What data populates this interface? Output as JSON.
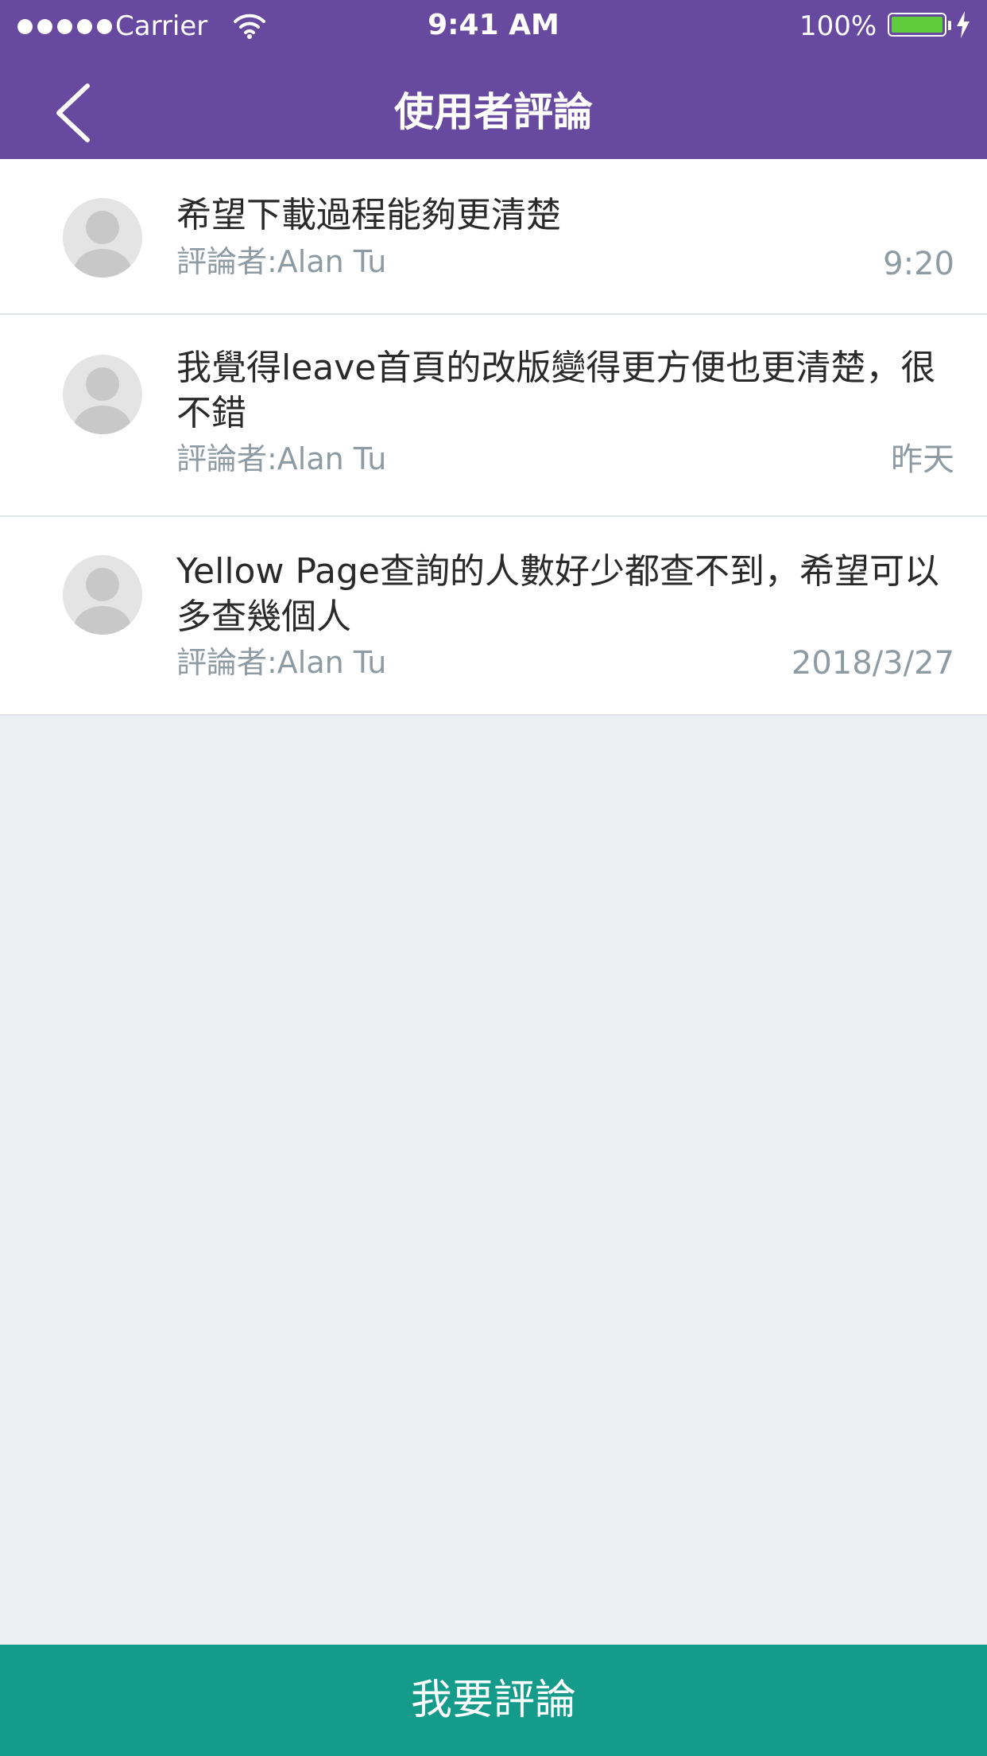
{
  "status_bar": {
    "carrier": "Carrier",
    "time": "9:41 AM",
    "battery_percent": "100%",
    "signal_bars": 5,
    "battery_level": 1.0,
    "battery_color": "#5fcb3d"
  },
  "header": {
    "title": "使用者評論",
    "back_icon": "chevron-left-icon",
    "background_color": "#67499f"
  },
  "reviews": [
    {
      "comment": "希望下載過程能夠更清楚",
      "reviewer": "評論者:Alan Tu",
      "date": "9:20",
      "avatar_icon": "user-avatar-icon"
    },
    {
      "comment": "我覺得leave首頁的改版變得更方便也更清楚，很不錯",
      "reviewer": "評論者:Alan Tu",
      "date": "昨天",
      "avatar_icon": "user-avatar-icon"
    },
    {
      "comment": "Yellow Page查詢的人數好少都查不到，希望可以多查幾個人",
      "reviewer": "評論者:Alan Tu",
      "date": "2018/3/27",
      "avatar_icon": "user-avatar-icon"
    }
  ],
  "footer": {
    "button_label": "我要評論",
    "button_color": "#149b8a"
  }
}
